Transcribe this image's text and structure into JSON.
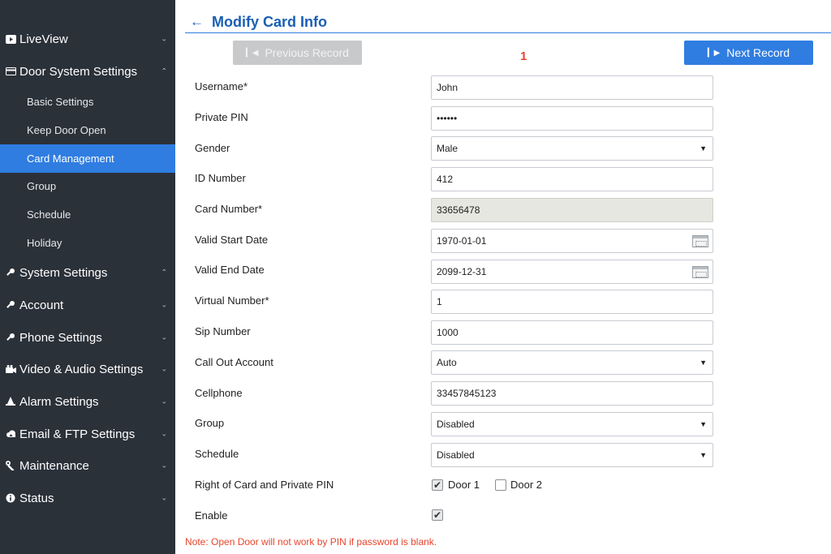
{
  "sidebar": {
    "liveview": {
      "label": "LiveView",
      "icon": "video-icon"
    },
    "door_system": {
      "label": "Door System Settings",
      "icon": "card-icon"
    },
    "sub_items": [
      "Basic Settings",
      "Keep Door Open",
      "Card Management",
      "Group",
      "Schedule",
      "Holiday"
    ],
    "active_sub": "Card Management",
    "system_settings": {
      "label": "System Settings",
      "icon": "key-icon"
    },
    "account": {
      "label": "Account",
      "icon": "key-icon"
    },
    "phone_settings": {
      "label": "Phone Settings",
      "icon": "key-icon"
    },
    "video_audio": {
      "label": "Video & Audio Settings",
      "icon": "camera-icon"
    },
    "alarm": {
      "label": "Alarm Settings",
      "icon": "bell-icon"
    },
    "email_ftp": {
      "label": "Email & FTP Settings",
      "icon": "cloud-icon"
    },
    "maintenance": {
      "label": "Maintenance",
      "icon": "wrench-icon"
    },
    "status": {
      "label": "Status",
      "icon": "info-icon"
    }
  },
  "header": {
    "title": "Modify Card Info"
  },
  "nav": {
    "prev_label": "Previous Record",
    "next_label": "Next Record",
    "record_number": "1"
  },
  "form": {
    "username": {
      "label": "Username*",
      "value": "John"
    },
    "private_pin": {
      "label": "Private PIN",
      "value": "••••••"
    },
    "gender": {
      "label": "Gender",
      "value": "Male"
    },
    "id_number": {
      "label": "ID Number",
      "value": "412"
    },
    "card_number": {
      "label": "Card Number*",
      "value": "33656478"
    },
    "valid_start": {
      "label": "Valid Start Date",
      "value": "1970-01-01"
    },
    "valid_end": {
      "label": "Valid End Date",
      "value": "2099-12-31"
    },
    "virtual_number": {
      "label": "Virtual Number*",
      "value": "1"
    },
    "sip_number": {
      "label": "Sip Number",
      "value": "1000"
    },
    "call_out": {
      "label": "Call Out Account",
      "value": "Auto"
    },
    "cellphone": {
      "label": "Cellphone",
      "value": "33457845123"
    },
    "group": {
      "label": "Group",
      "value": "Disabled"
    },
    "schedule": {
      "label": "Schedule",
      "value": "Disabled"
    },
    "rights": {
      "label": "Right of Card and Private PIN",
      "door1": "Door 1",
      "door1_checked": true,
      "door2": "Door 2",
      "door2_checked": false
    },
    "enable": {
      "label": "Enable",
      "checked": true
    }
  },
  "note": "Note: Open Door will not work by PIN if password is blank.",
  "colors": {
    "sidebar_bg": "#2b3139",
    "accent": "#2f7de1",
    "title": "#1a5fb4",
    "warning": "#e8452c"
  }
}
